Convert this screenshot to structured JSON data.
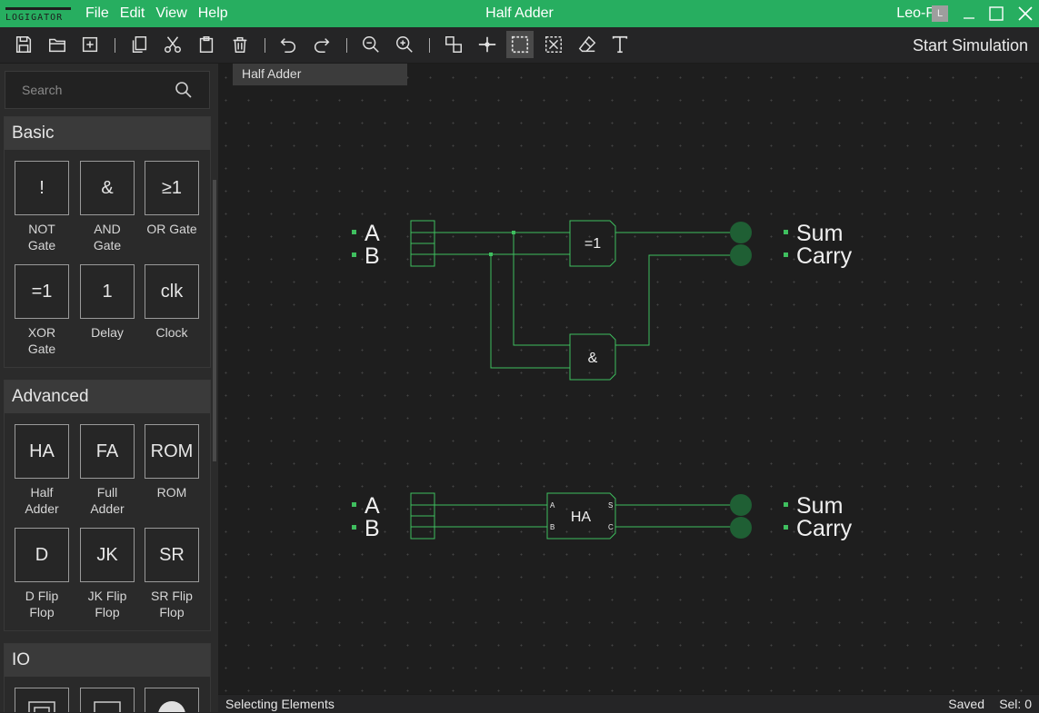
{
  "app": {
    "logo_text": "LOGIGATOR",
    "title": "Half Adder",
    "user_name": "Leo-P",
    "user_initial": "L",
    "accent": "#27ae60"
  },
  "menu": {
    "file": "File",
    "edit": "Edit",
    "view": "View",
    "help": "Help"
  },
  "toolbar": {
    "icons": [
      "save-icon",
      "open-folder-icon",
      "new-project-icon",
      "copy-icon",
      "cut-icon",
      "paste-icon",
      "delete-icon",
      "undo-icon",
      "redo-icon",
      "zoom-out-icon",
      "zoom-in-icon",
      "place-component-icon",
      "wire-icon",
      "select-icon",
      "cut-select-icon",
      "eraser-icon",
      "text-icon"
    ],
    "active_tool": "select-icon",
    "start_simulation": "Start Simulation"
  },
  "sidebar": {
    "search_placeholder": "Search",
    "basic": {
      "title": "Basic",
      "items": [
        {
          "symbol": "!",
          "label": "NOT Gate"
        },
        {
          "symbol": "&",
          "label": "AND Gate"
        },
        {
          "symbol": "≥1",
          "label": "OR Gate"
        },
        {
          "symbol": "=1",
          "label": "XOR Gate"
        },
        {
          "symbol": "1",
          "label": "Delay"
        },
        {
          "symbol": "clk",
          "label": "Clock"
        }
      ]
    },
    "advanced": {
      "title": "Advanced",
      "items": [
        {
          "symbol": "HA",
          "label": "Half Adder"
        },
        {
          "symbol": "FA",
          "label": "Full Adder"
        },
        {
          "symbol": "ROM",
          "label": "ROM"
        },
        {
          "symbol": "D",
          "label": "D Flip Flop"
        },
        {
          "symbol": "JK",
          "label": "JK Flip Flop"
        },
        {
          "symbol": "SR",
          "label": "SR Flip Flop"
        }
      ]
    },
    "io": {
      "title": "IO"
    }
  },
  "canvas": {
    "tab_label": "Half Adder",
    "inputs": [
      "A",
      "B"
    ],
    "outputs": [
      "Sum",
      "Carry"
    ],
    "xor_symbol": "=1",
    "and_symbol": "&",
    "ha_symbol": "HA",
    "ha_pins": {
      "a": "A",
      "b": "B",
      "s": "S",
      "c": "C"
    },
    "wire_color": "#3fbf5f",
    "led_color": "#1f5f34"
  },
  "status": {
    "mode": "Selecting Elements",
    "saved": "Saved",
    "selection": "Sel: 0"
  }
}
